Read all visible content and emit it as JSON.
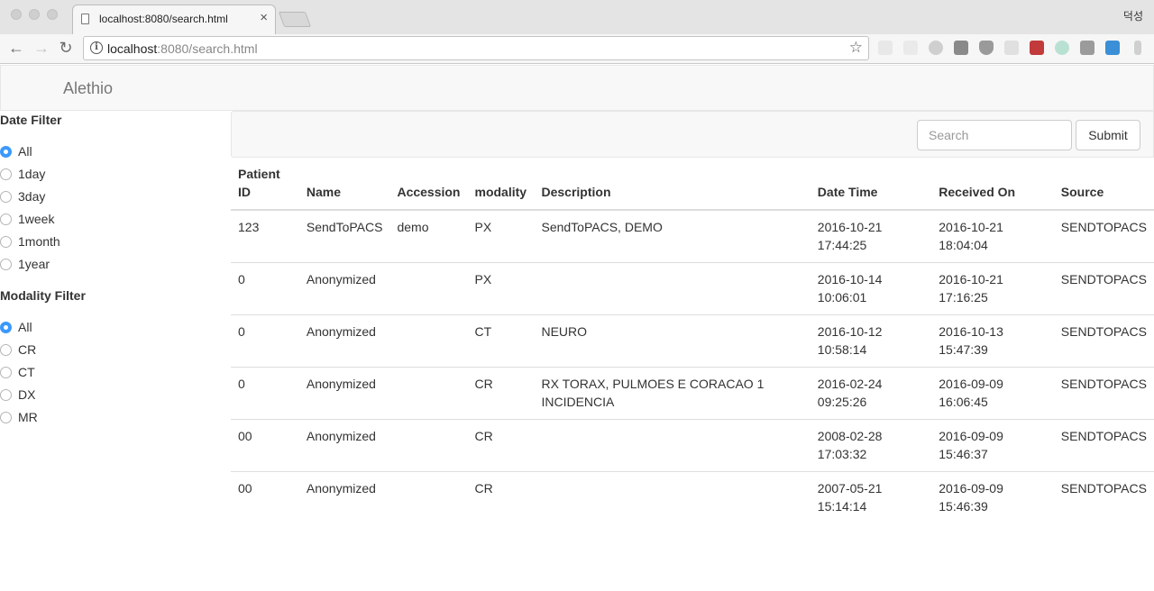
{
  "browser": {
    "tab_title": "localhost:8080/search.html",
    "tab_close": "×",
    "profile_name": "덕성",
    "url_host": "localhost",
    "url_rest": ":8080/search.html",
    "back_glyph": "←",
    "forward_glyph": "→",
    "reload_glyph": "↻",
    "info_glyph": "i",
    "star_glyph": "☆",
    "extension_icons": [
      "extension-icon",
      "ebay-icon",
      "cloud-icon",
      "shield-icon",
      "pocket-icon",
      "extension-icon",
      "extension-icon",
      "color-icon",
      "vimeo-icon",
      "screenshot-icon",
      "more-icon"
    ]
  },
  "navbar": {
    "brand": "Alethio"
  },
  "date_filter": {
    "heading": "Date Filter",
    "options": [
      "All",
      "1day",
      "3day",
      "1week",
      "1month",
      "1year"
    ],
    "selected": "All"
  },
  "modality_filter": {
    "heading": "Modality Filter",
    "options": [
      "All",
      "CR",
      "CT",
      "DX",
      "MR"
    ],
    "selected": "All"
  },
  "search": {
    "placeholder": "Search",
    "value": "",
    "submit_label": "Submit"
  },
  "table": {
    "headers": [
      "Patient\nID",
      "Name",
      "Accession",
      "modality",
      "Description",
      "Date Time",
      "Received On",
      "Source"
    ],
    "rows": [
      [
        "123",
        "SendToPACS",
        "demo",
        "PX",
        "SendToPACS, DEMO",
        "2016-10-21\n17:44:25",
        "2016-10-21\n18:04:04",
        "SENDTOPACS"
      ],
      [
        "0",
        "Anonymized",
        "",
        "PX",
        "",
        "2016-10-14\n10:06:01",
        "2016-10-21\n17:16:25",
        "SENDTOPACS"
      ],
      [
        "0",
        "Anonymized",
        "",
        "CT",
        "NEURO",
        "2016-10-12\n10:58:14",
        "2016-10-13\n15:47:39",
        "SENDTOPACS"
      ],
      [
        "0",
        "Anonymized",
        "",
        "CR",
        "RX TORAX, PULMOES E CORACAO 1\nINCIDENCIA",
        "2016-02-24\n09:25:26",
        "2016-09-09\n16:06:45",
        "SENDTOPACS"
      ],
      [
        "00",
        "Anonymized",
        "",
        "CR",
        "",
        "2008-02-28\n17:03:32",
        "2016-09-09\n15:46:37",
        "SENDTOPACS"
      ],
      [
        "00",
        "Anonymized",
        "",
        "CR",
        "",
        "2007-05-21\n15:14:14",
        "2016-09-09\n15:46:39",
        "SENDTOPACS"
      ]
    ]
  },
  "colors": {
    "accent": "#3b99fc",
    "navbar_bg": "#f8f8f8",
    "brand": "#777777"
  }
}
